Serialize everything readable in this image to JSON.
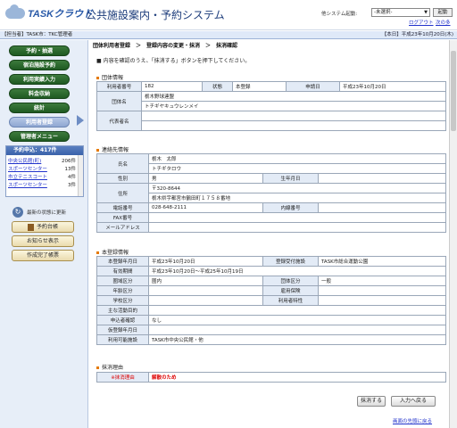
{
  "header": {
    "logo": "TASKクラウド",
    "title": "公共施設案内・予約システム",
    "other_system_label": "他システム起動:",
    "system_select": "-未選択-",
    "start_button": "起動",
    "logout": "ログアウト",
    "next_link": "次の多"
  },
  "infobar": {
    "left": "【担当者】TASK市：TKC管理者",
    "right": "【本日】平成23年10月20日(木)"
  },
  "sidebar": {
    "menu": [
      "予約・抽選",
      "宿泊施設予約",
      "利用実績入力",
      "料金収納",
      "統計",
      "利用者登録",
      "管理者メニュー"
    ],
    "active_index": 5,
    "request_title": "予約申込：417件",
    "requests": [
      {
        "name": "中央公民館(町)",
        "count": "206件"
      },
      {
        "name": "スポーツセンター",
        "count": "13件"
      },
      {
        "name": "市立テニスコート",
        "count": "4件"
      },
      {
        "name": "スポーツセンター",
        "count": "3件"
      }
    ],
    "refresh": "最新の状態に更新",
    "buttons": [
      "予約台帳",
      "お知らせ表示",
      "作成完了帳票"
    ]
  },
  "breadcrumb": "団体利用者登録　＞　登録内容の変更・抹消　＞　抹消確認",
  "note": "内容を確認のうえ、「抹消する」ボタンを押下してください。",
  "group": {
    "section": "団体情報",
    "user_no_label": "利用者番号",
    "user_no": "182",
    "status_label": "状態",
    "status": "本登録",
    "apply_date_label": "申請日",
    "apply_date": "平成23年10月20日",
    "group_name_label": "団体名",
    "group_name": "栃木野球連盟",
    "group_kana": "トチギヤキュウレンメイ",
    "rep_label": "代表者名",
    "rep": ""
  },
  "contact": {
    "section": "連絡先情報",
    "name_label": "氏名",
    "name": "栃木　太郎",
    "kana": "トチギタロウ",
    "gender_label": "性別",
    "gender": "男",
    "birth_label": "生年月日",
    "birth": "",
    "address_label": "住所",
    "zip": "〒320-8644",
    "address": "栃木県宇都宮市鶴田町１７５８番地",
    "phone_label": "電話番号",
    "phone": "028-648-2111",
    "ext_label": "内線番号",
    "ext": "",
    "fax_label": "FAX番号",
    "fax": "",
    "mail_label": "メールアドレス",
    "mail": ""
  },
  "registration": {
    "section": "本登録情報",
    "reg_date_label": "本登録年月日",
    "reg_date": "平成23年10月20日",
    "facility_label": "登録受付施設",
    "facility": "TASK市総合運動公園",
    "period_label": "有効期間",
    "period": "平成23年10月20日～平成25年10月19日",
    "area_label": "圏域区分",
    "area": "圏内",
    "type_label": "団体区分",
    "type": "一般",
    "age_label": "年齢区分",
    "age": "",
    "employ_label": "雇用保険",
    "employ": "",
    "school_label": "学校区分",
    "school": "",
    "trait_label": "利用者特性",
    "trait": "",
    "purpose_label": "主な活動目的",
    "purpose": "",
    "stop_label": "申込者確認",
    "stop": "なし",
    "tmp_label": "仮登録年月日",
    "tmp": "",
    "avail_label": "利用可能施設",
    "avail": "TASK市中央公民館・他"
  },
  "reason": {
    "section": "抹消理由",
    "label": "※抹消理由",
    "value": "解散のため"
  },
  "actions": {
    "delete": "抹消する",
    "back": "入力へ戻る",
    "top": "画面の先頭に戻る"
  }
}
